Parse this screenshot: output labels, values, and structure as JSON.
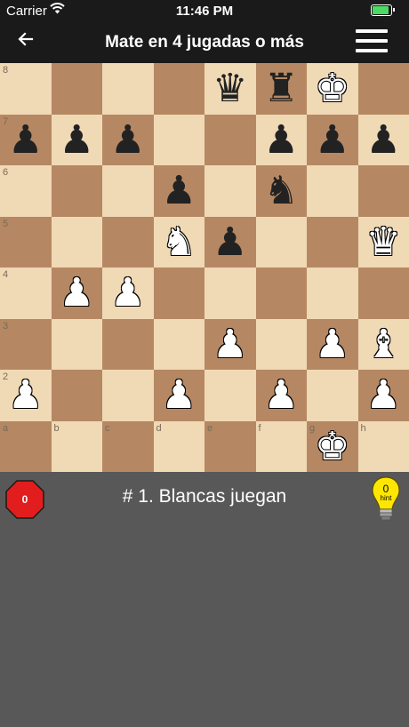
{
  "status_bar": {
    "carrier": "Carrier",
    "time": "11:46 PM"
  },
  "nav": {
    "title": "Mate en 4 jugadas o más",
    "back_icon": "arrow-left-icon",
    "menu_icon": "hamburger-menu-icon"
  },
  "board": {
    "files": [
      "a",
      "b",
      "c",
      "d",
      "e",
      "f",
      "g",
      "h"
    ],
    "ranks": [
      "8",
      "7",
      "6",
      "5",
      "4",
      "3",
      "2"
    ],
    "light_color": "#f0d9b5",
    "dark_color": "#b58863",
    "pieces": [
      {
        "square": "e8",
        "glyph": "♛",
        "color": "black",
        "name": "black-queen-icon"
      },
      {
        "square": "f8",
        "glyph": "♜",
        "color": "black",
        "name": "black-rook-icon"
      },
      {
        "square": "g8",
        "glyph": "♚",
        "color": "white",
        "name": "white-king-icon"
      },
      {
        "square": "a7",
        "glyph": "♟",
        "color": "black",
        "name": "black-pawn-icon"
      },
      {
        "square": "b7",
        "glyph": "♟",
        "color": "black",
        "name": "black-pawn-icon"
      },
      {
        "square": "c7",
        "glyph": "♟",
        "color": "black",
        "name": "black-pawn-icon"
      },
      {
        "square": "f7",
        "glyph": "♟",
        "color": "black",
        "name": "black-pawn-icon"
      },
      {
        "square": "g7",
        "glyph": "♟",
        "color": "black",
        "name": "black-pawn-icon"
      },
      {
        "square": "h7",
        "glyph": "♟",
        "color": "black",
        "name": "black-pawn-icon"
      },
      {
        "square": "d6",
        "glyph": "♟",
        "color": "black",
        "name": "black-pawn-icon"
      },
      {
        "square": "f6",
        "glyph": "♞",
        "color": "black",
        "name": "black-knight-icon"
      },
      {
        "square": "d5",
        "glyph": "♞",
        "color": "white",
        "name": "white-knight-icon"
      },
      {
        "square": "e5",
        "glyph": "♟",
        "color": "black",
        "name": "black-pawn-icon"
      },
      {
        "square": "h5",
        "glyph": "♛",
        "color": "white",
        "name": "white-queen-icon"
      },
      {
        "square": "b4",
        "glyph": "♟",
        "color": "white",
        "name": "white-pawn-icon"
      },
      {
        "square": "c4",
        "glyph": "♟",
        "color": "white",
        "name": "white-pawn-icon"
      },
      {
        "square": "e3",
        "glyph": "♟",
        "color": "white",
        "name": "white-pawn-icon"
      },
      {
        "square": "g3",
        "glyph": "♟",
        "color": "white",
        "name": "white-pawn-icon"
      },
      {
        "square": "h3",
        "glyph": "♝",
        "color": "white",
        "name": "white-bishop-icon"
      },
      {
        "square": "a2",
        "glyph": "♟",
        "color": "white",
        "name": "white-pawn-icon"
      },
      {
        "square": "d2",
        "glyph": "♟",
        "color": "white",
        "name": "white-pawn-icon"
      },
      {
        "square": "f2",
        "glyph": "♟",
        "color": "white",
        "name": "white-pawn-icon"
      },
      {
        "square": "h2",
        "glyph": "♟",
        "color": "white",
        "name": "white-pawn-icon"
      },
      {
        "square": "g1",
        "glyph": "♚",
        "color": "white",
        "name": "white-king-icon"
      }
    ]
  },
  "game": {
    "mistakes_count": "0",
    "turn_text": "# 1. Blancas juegan",
    "hint_count": "0",
    "hint_label": "hint"
  }
}
